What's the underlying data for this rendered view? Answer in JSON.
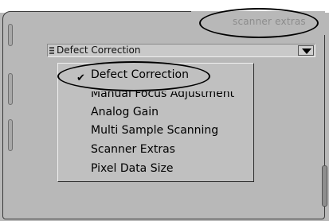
{
  "tab": {
    "label": "scanner extras"
  },
  "dropdown": {
    "selected": "Defect Correction"
  },
  "menu": {
    "items": [
      {
        "label": "Defect Correction",
        "checked": true
      },
      {
        "label": "Manual Focus Adjustment",
        "checked": false
      },
      {
        "label": "Analog Gain",
        "checked": false
      },
      {
        "label": "Multi Sample Scanning",
        "checked": false
      },
      {
        "label": "Scanner Extras",
        "checked": false
      },
      {
        "label": "Pixel Data Size",
        "checked": false
      }
    ],
    "check_glyph": "✔"
  }
}
